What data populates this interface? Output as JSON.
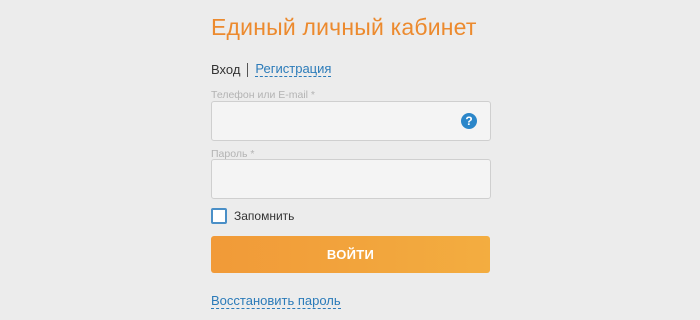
{
  "title": "Единый личный кабинет",
  "tabs": {
    "login": "Вход",
    "register": "Регистрация"
  },
  "fields": {
    "phone_label": "Телефон или E-mail *",
    "phone_value": "",
    "password_label": "Пароль *",
    "password_value": ""
  },
  "help_icon": "?",
  "remember": {
    "label": "Запомнить",
    "checked": false
  },
  "login_button": "ВОЙТИ",
  "restore_link": "Восстановить пароль",
  "colors": {
    "accent_orange": "#ec8a2e",
    "link_blue": "#2b7bb9",
    "background": "#ececec"
  }
}
